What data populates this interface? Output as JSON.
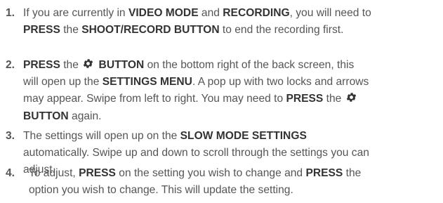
{
  "steps": [
    {
      "number": "1.",
      "lines": [
        [
          {
            "t": "If you are currently in "
          },
          {
            "t": "VIDEO MODE",
            "b": true
          },
          {
            "t": " and "
          },
          {
            "t": "RECORDING",
            "b": true
          },
          {
            "t": ", you will need to"
          }
        ],
        [
          {
            "t": "PRESS",
            "b": true
          },
          {
            "t": " the "
          },
          {
            "t": "SHOOT/RECORD BUTTON",
            "b": true
          },
          {
            "t": " to end the recording first."
          }
        ]
      ]
    },
    {
      "number": "2.",
      "lines": [
        [
          {
            "t": "PRESS",
            "b": true
          },
          {
            "t": " the "
          },
          {
            "icon": "gear-icon"
          },
          {
            "t": " BUTTON",
            "b": true
          },
          {
            "t": " on the bottom right of the back screen, this"
          }
        ],
        [
          {
            "t": "will open up the "
          },
          {
            "t": "SETTINGS MENU",
            "b": true
          },
          {
            "t": ". A pop up with two locks and arrows"
          }
        ],
        [
          {
            "t": "may appear. Swipe from left to right. You may need to "
          },
          {
            "t": "PRESS",
            "b": true
          },
          {
            "t": " the "
          },
          {
            "icon": "gear-icon"
          }
        ],
        [
          {
            "t": "BUTTON",
            "b": true
          },
          {
            "t": " again."
          }
        ]
      ]
    },
    {
      "number": "3.",
      "lines": [
        [
          {
            "t": "The settings will open up on the "
          },
          {
            "t": "SLOW MODE SETTINGS",
            "b": true
          }
        ],
        [
          {
            "t": "automatically. Swipe up and down to scroll through the settings you can"
          }
        ],
        [
          {
            "t": "adjust."
          }
        ]
      ]
    },
    {
      "number": "4.",
      "lines": [
        [
          {
            "t": "To adjust, "
          },
          {
            "t": "PRESS",
            "b": true
          },
          {
            "t": " on the setting you wish to change and "
          },
          {
            "t": "PRESS",
            "b": true
          },
          {
            "t": " the"
          }
        ],
        [
          {
            "t": "option you wish to change. This will update the setting."
          }
        ]
      ]
    }
  ]
}
